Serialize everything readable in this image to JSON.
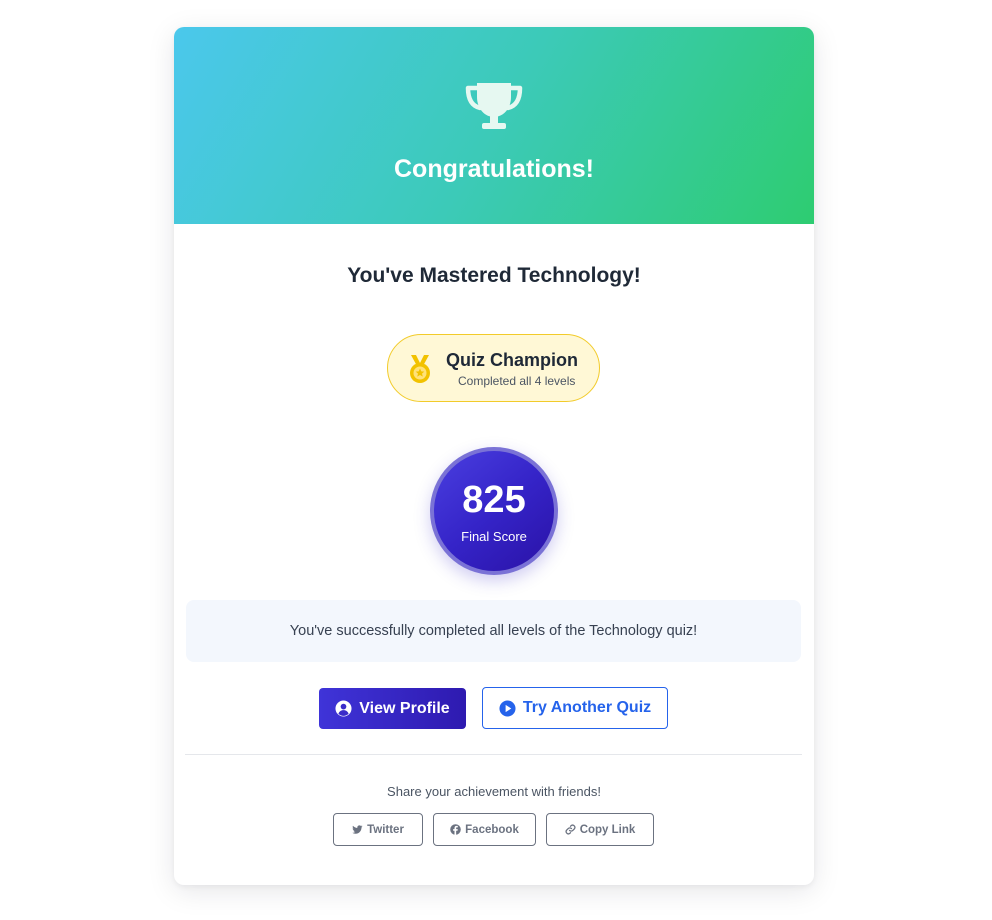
{
  "header": {
    "icon": "trophy-icon",
    "title": "Congratulations!",
    "gradient": [
      "#4bc8ec",
      "#2ecc71"
    ]
  },
  "result": {
    "subtitle": "You've Mastered Technology!"
  },
  "badge": {
    "icon": "medal-icon",
    "title": "Quiz Champion",
    "subtitle": "Completed all 4 levels",
    "color": "#f2cb2a"
  },
  "score": {
    "value": "825",
    "label": "Final Score",
    "color": "#3524c8"
  },
  "message": "You've successfully completed all levels of the Technology quiz!",
  "actions": {
    "view_profile": {
      "label": "View Profile",
      "icon": "user-circle-icon"
    },
    "try_another": {
      "label": "Try Another Quiz",
      "icon": "play-circle-icon"
    }
  },
  "share": {
    "text": "Share your achievement with friends!",
    "buttons": [
      {
        "label": "Twitter",
        "icon": "twitter-icon"
      },
      {
        "label": "Facebook",
        "icon": "facebook-icon"
      },
      {
        "label": "Copy Link",
        "icon": "link-icon"
      }
    ]
  }
}
